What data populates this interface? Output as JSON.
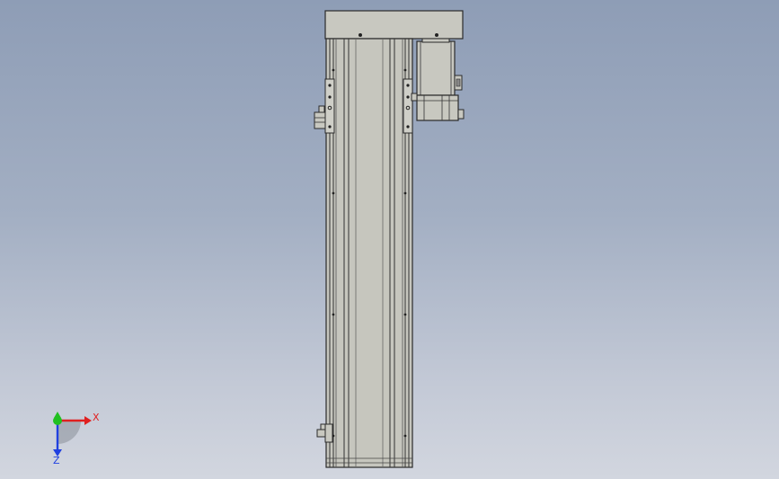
{
  "colors": {
    "background_top": "#8e9db6",
    "background_bottom": "#d2d6df",
    "body_fill": "#c9c9c1",
    "body_edge": "#2a2a2a",
    "x_axis": "#e02020",
    "y_axis": "#20c020",
    "z_axis": "#2040e0"
  },
  "triad": {
    "x_label": "X",
    "z_label": "Z"
  },
  "icons": {
    "triad": "xyz-axis-triad-icon"
  }
}
